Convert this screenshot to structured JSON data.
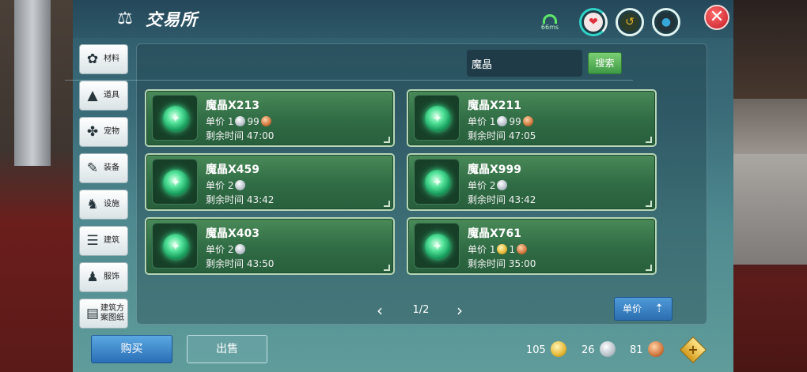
{
  "window": {
    "title": "交易所",
    "title_icon": "scales-icon"
  },
  "status": {
    "ping": "66ms",
    "stats": [
      {
        "name": "health-icon",
        "glyph": "❤",
        "color": "#e0313d"
      },
      {
        "name": "hunger-icon",
        "glyph": "↺",
        "color": "#e8b32a"
      },
      {
        "name": "water-icon",
        "glyph": "💧",
        "color": "#35a7d8"
      }
    ]
  },
  "sidebar": {
    "items": [
      {
        "label": "材料",
        "icon": "materials-icon",
        "glyph": "✿"
      },
      {
        "label": "道具",
        "icon": "item-icon",
        "glyph": "▲"
      },
      {
        "label": "宠物",
        "icon": "pet-paw-icon",
        "glyph": "✤"
      },
      {
        "label": "装备",
        "icon": "equipment-icon",
        "glyph": "✎"
      },
      {
        "label": "设施",
        "icon": "facility-icon",
        "glyph": "♞"
      },
      {
        "label": "建筑",
        "icon": "building-icon",
        "glyph": "☰"
      },
      {
        "label": "服饰",
        "icon": "clothing-icon",
        "glyph": "♟"
      },
      {
        "label": "建筑方案图纸",
        "icon": "blueprint-icon",
        "glyph": "▤"
      }
    ]
  },
  "search": {
    "value": "魔晶",
    "button_label": "搜索"
  },
  "listings": [
    {
      "name": "魔晶X213",
      "price_label": "单价",
      "price": [
        {
          "amount": "1",
          "coin": "silver"
        },
        {
          "amount": "99",
          "coin": "copper"
        }
      ],
      "time_label": "剩余时间",
      "time": "47:00"
    },
    {
      "name": "魔晶X211",
      "price_label": "单价",
      "price": [
        {
          "amount": "1",
          "coin": "silver"
        },
        {
          "amount": "99",
          "coin": "copper"
        }
      ],
      "time_label": "剩余时间",
      "time": "47:05"
    },
    {
      "name": "魔晶X459",
      "price_label": "单价",
      "price": [
        {
          "amount": "2",
          "coin": "silver"
        }
      ],
      "time_label": "剩余时间",
      "time": "43:42"
    },
    {
      "name": "魔晶X999",
      "price_label": "单价",
      "price": [
        {
          "amount": "2",
          "coin": "silver"
        }
      ],
      "time_label": "剩余时间",
      "time": "43:42"
    },
    {
      "name": "魔晶X403",
      "price_label": "单价",
      "price": [
        {
          "amount": "2",
          "coin": "silver"
        }
      ],
      "time_label": "剩余时间",
      "time": "43:50"
    },
    {
      "name": "魔晶X761",
      "price_label": "单价",
      "price": [
        {
          "amount": "1",
          "coin": "gold"
        },
        {
          "amount": "1",
          "coin": "copper"
        }
      ],
      "time_label": "剩余时间",
      "time": "35:00"
    }
  ],
  "pager": {
    "text": "1/2"
  },
  "sort": {
    "label": "单价"
  },
  "bottom": {
    "buy_label": "购买",
    "sell_label": "出售"
  },
  "wallet": {
    "gold": "105",
    "silver": "26",
    "copper": "81"
  },
  "colors": {
    "accent_green": "#3f9a45",
    "accent_blue": "#2a6fb6",
    "close_red": "#c31d26"
  }
}
